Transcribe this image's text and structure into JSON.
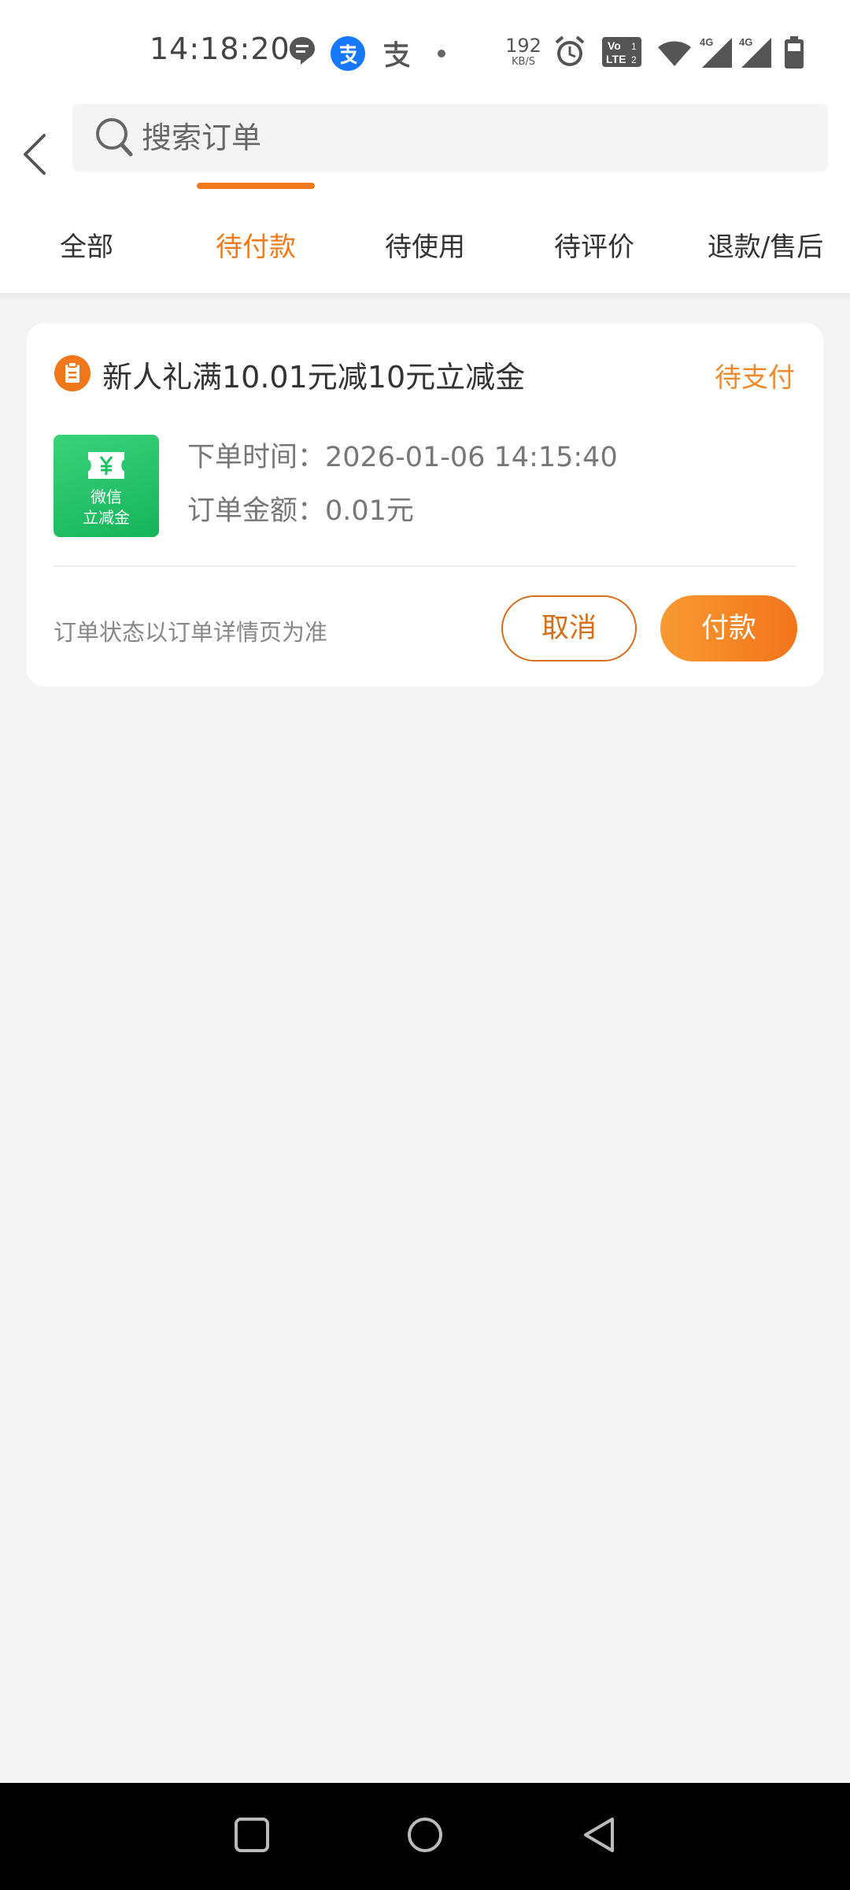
{
  "status_bar": {
    "time": "14:18:20",
    "net_speed_value": "192",
    "net_speed_unit": "KB/S",
    "icons": [
      "message-icon",
      "alipay-icon",
      "alipay-outline-icon",
      "dot-icon",
      "alarm-icon",
      "volte-icon",
      "wifi-icon",
      "4g-signal-icon",
      "4g-signal-icon",
      "battery-icon"
    ]
  },
  "header": {
    "search_placeholder": "搜索订单"
  },
  "tabs": [
    {
      "label": "全部",
      "active": false
    },
    {
      "label": "待付款",
      "active": true
    },
    {
      "label": "待使用",
      "active": false
    },
    {
      "label": "待评价",
      "active": false
    },
    {
      "label": "退款/售后",
      "active": false
    }
  ],
  "order": {
    "title": "新人礼满10.01元减10元立减金",
    "status": "待支付",
    "thumb_line1": "微信",
    "thumb_line2": "立减金",
    "order_time": "下单时间：2026-01-06 14:15:40",
    "order_amount": "订单金额：0.01元",
    "note": "订单状态以订单详情页为准",
    "cancel_label": "取消",
    "pay_label": "付款"
  },
  "colors": {
    "accent": "#f07a1a",
    "thumb_green": "#1dbf63"
  }
}
